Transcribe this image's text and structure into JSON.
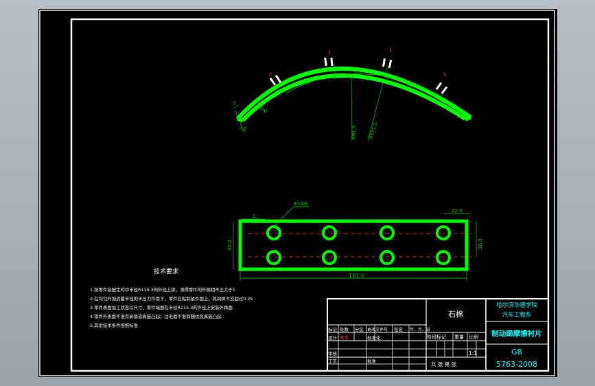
{
  "colors": {
    "background": "#000000",
    "frame": "#ffffff",
    "part": "#00ff00",
    "dimension": "#00d000",
    "centerline": "#ff3030",
    "text": "#ffffff",
    "title_cyan": "#00ffff"
  },
  "arc_view": {
    "dims": {
      "ang1": "23°",
      "ang2": "23°",
      "ang3": "23°",
      "d50": "5.0",
      "d25": "2.5",
      "r_inner": "R91.5",
      "r_outer": "R101.5",
      "d7": "7"
    }
  },
  "plan_view": {
    "hole_label": "8×Ø6",
    "dim_top_left": "2",
    "dim_width": "181.0",
    "dim_height_left": "40.0",
    "dim_height_right": "20.0",
    "dim_spacing": "22.0"
  },
  "tech": {
    "title": "技术要求",
    "items": [
      "1.按零件装配定的中半径R115.3的外径上铆，测得零件的外偏相不正大于1.",
      "2.在均匀外加适量半径的半压力作用下，零件应贴制紧件固上，其间隙不应超过0.25",
      "3.零件表面加工状态以尺寸，零件端面在半径R115.3的外径上安装外再面.",
      "4.零件外表面不准有剥落或真鼓凸起；注毛面不准有翘纹及真鼓凸起.",
      "5.其余技术条件按照标准."
    ]
  },
  "title_block": {
    "material": "石棉",
    "school_line1": "哈尔滨华德学院",
    "school_line2": "汽车工程系",
    "part_name": "制动蹄摩擦衬片",
    "std_1": "GB",
    "std_2": "5763-2008",
    "scale": "1:1",
    "row_mark": "标记",
    "row_count": "处数",
    "row_zone": "分区",
    "row_doc": "更改文件号",
    "row_sign": "签名",
    "row_date": "年、月、日",
    "design": "设计",
    "design_name": "李宇",
    "standard": "标准化",
    "stage": "阶段标记",
    "weight": "重量",
    "ratio": "比例",
    "check": "审核",
    "process": "工艺",
    "approve": "批准",
    "sheets": "共 张 第 张"
  }
}
